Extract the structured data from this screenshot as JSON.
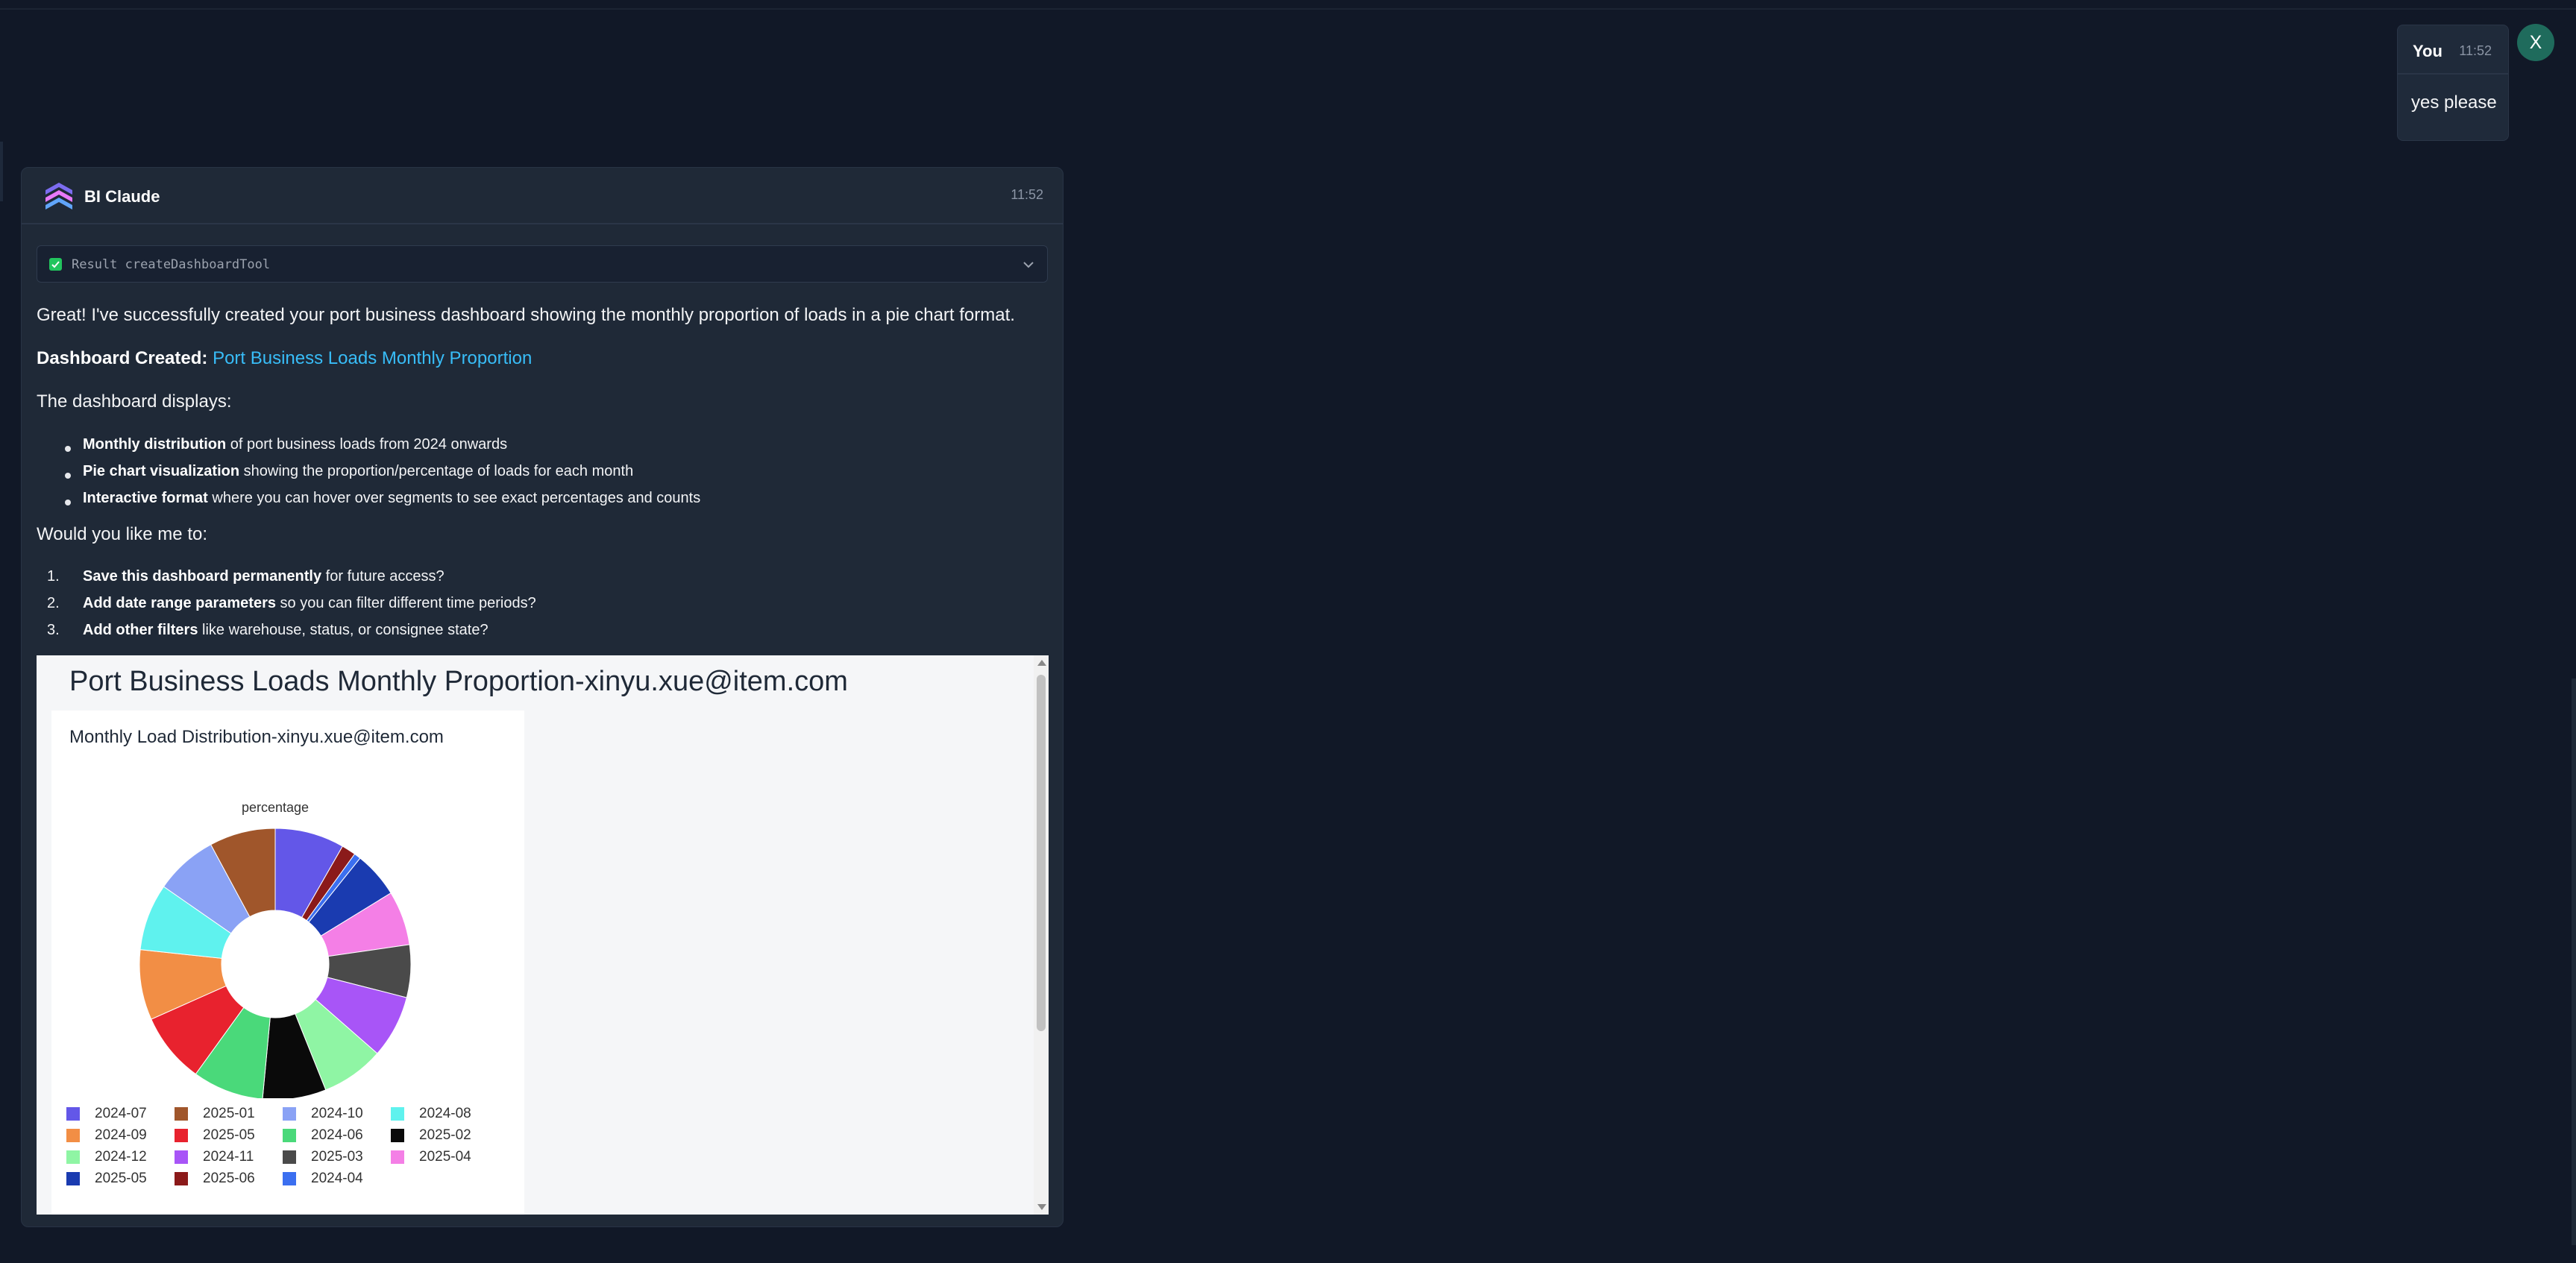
{
  "user": {
    "name": "You",
    "time": "11:52",
    "message": "yes please",
    "avatar_initial": "X"
  },
  "assistant": {
    "name": "BI Claude",
    "time": "11:52",
    "tool_result": "Result createDashboardTool",
    "intro": "Great! I've successfully created your port business dashboard showing the monthly proportion of loads in a pie chart format.",
    "created_label": "Dashboard Created:",
    "created_link": "Port Business Loads Monthly Proportion",
    "displays_heading": "The dashboard displays:",
    "bullets": [
      {
        "bold": "Monthly distribution",
        "rest": " of port business loads from 2024 onwards"
      },
      {
        "bold": "Pie chart visualization",
        "rest": " showing the proportion/percentage of loads for each month"
      },
      {
        "bold": "Interactive format",
        "rest": " where you can hover over segments to see exact percentages and counts"
      }
    ],
    "question": "Would you like me to:",
    "options": [
      {
        "n": "1.",
        "bold": "Save this dashboard permanently",
        "rest": " for future access?"
      },
      {
        "n": "2.",
        "bold": "Add date range parameters",
        "rest": " so you can filter different time periods?"
      },
      {
        "n": "3.",
        "bold": "Add other filters",
        "rest": " like warehouse, status, or consignee state?"
      }
    ]
  },
  "dashboard": {
    "title": "Port Business Loads Monthly Proportion-xinyu.xue@item.com",
    "panel_title": "Monthly Load Distribution-xinyu.xue@item.com"
  },
  "chart_data": {
    "type": "pie",
    "title": "percentage",
    "donut": true,
    "legend_position": "bottom",
    "slices": [
      {
        "label": "2024-07",
        "value": 8.3,
        "color": "#6357e8"
      },
      {
        "label": "2025-06",
        "value": 1.7,
        "color": "#8b1a1a"
      },
      {
        "label": "2024-04",
        "value": 0.8,
        "color": "#3b6ff0"
      },
      {
        "label": "2025-05",
        "value": 5.5,
        "color": "#1a3bb0"
      },
      {
        "label": "2025-04",
        "value": 6.5,
        "color": "#f47fe6"
      },
      {
        "label": "2025-03",
        "value": 6.3,
        "color": "#4a4a4a"
      },
      {
        "label": "2024-11",
        "value": 7.5,
        "color": "#a855f7"
      },
      {
        "label": "2024-12",
        "value": 7.5,
        "color": "#8ff5a4"
      },
      {
        "label": "2025-02",
        "value": 7.6,
        "color": "#0a0a0a"
      },
      {
        "label": "2025-06 ",
        "value": 0,
        "color": "#000000"
      },
      {
        "label": "2024-06",
        "value": 8.5,
        "color": "#4ad97a"
      },
      {
        "label": "2025-05 ",
        "value": 0,
        "color": "#000000"
      },
      {
        "label": "2024-05",
        "value": 8.4,
        "color": "#e8222e"
      },
      {
        "label": "2024-09",
        "value": 8.4,
        "color": "#f28e45"
      },
      {
        "label": "2024-08",
        "value": 8.0,
        "color": "#5ff2ee"
      },
      {
        "label": "2024-10",
        "value": 7.5,
        "color": "#8aa2f5"
      },
      {
        "label": "2025-01",
        "value": 7.9,
        "color": "#a0562b"
      }
    ],
    "legend": [
      {
        "label": "2024-07",
        "color": "#6357e8"
      },
      {
        "label": "2025-01",
        "color": "#a0562b"
      },
      {
        "label": "2024-10",
        "color": "#8aa2f5"
      },
      {
        "label": "2024-08",
        "color": "#5ff2ee"
      },
      {
        "label": "2024-09",
        "color": "#f28e45"
      },
      {
        "label": "2025-05",
        "color": "#e8222e"
      },
      {
        "label": "2024-06",
        "color": "#4ad97a"
      },
      {
        "label": "2025-02",
        "color": "#0a0a0a"
      },
      {
        "label": "2024-12",
        "color": "#8ff5a4"
      },
      {
        "label": "2024-11",
        "color": "#a855f7"
      },
      {
        "label": "2025-03",
        "color": "#4a4a4a"
      },
      {
        "label": "2025-04",
        "color": "#f47fe6"
      },
      {
        "label": "2025-05",
        "color": "#1a3bb0"
      },
      {
        "label": "2025-06",
        "color": "#8b1a1a"
      },
      {
        "label": "2024-04",
        "color": "#3b6ff0"
      }
    ]
  }
}
